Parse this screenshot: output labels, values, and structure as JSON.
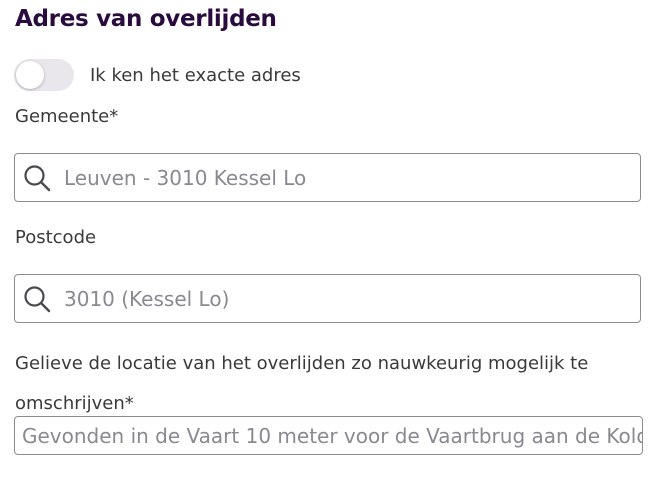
{
  "section": {
    "title": "Adres van overlijden"
  },
  "exact_address_toggle": {
    "label": "Ik ken het exacte adres",
    "checked": false
  },
  "municipality": {
    "label": "Gemeente*",
    "value": "Leuven - 3010 Kessel Lo",
    "icon": "search-icon"
  },
  "postcode": {
    "label": "Postcode",
    "value": "3010 (Kessel Lo)",
    "icon": "search-icon"
  },
  "location_description": {
    "label": "Gelieve de locatie van het overlijden zo nauwkeurig mogelijk te omschrijven*",
    "value": "Gevonden in de Vaart 10 meter voor de Vaartbrug aan de Kolo"
  },
  "colors": {
    "title": "#2a0b3e",
    "text": "#3a3a3a",
    "placeholder": "#8a8890",
    "border": "#8e8c91",
    "toggle_track": "#e9e7ec"
  }
}
